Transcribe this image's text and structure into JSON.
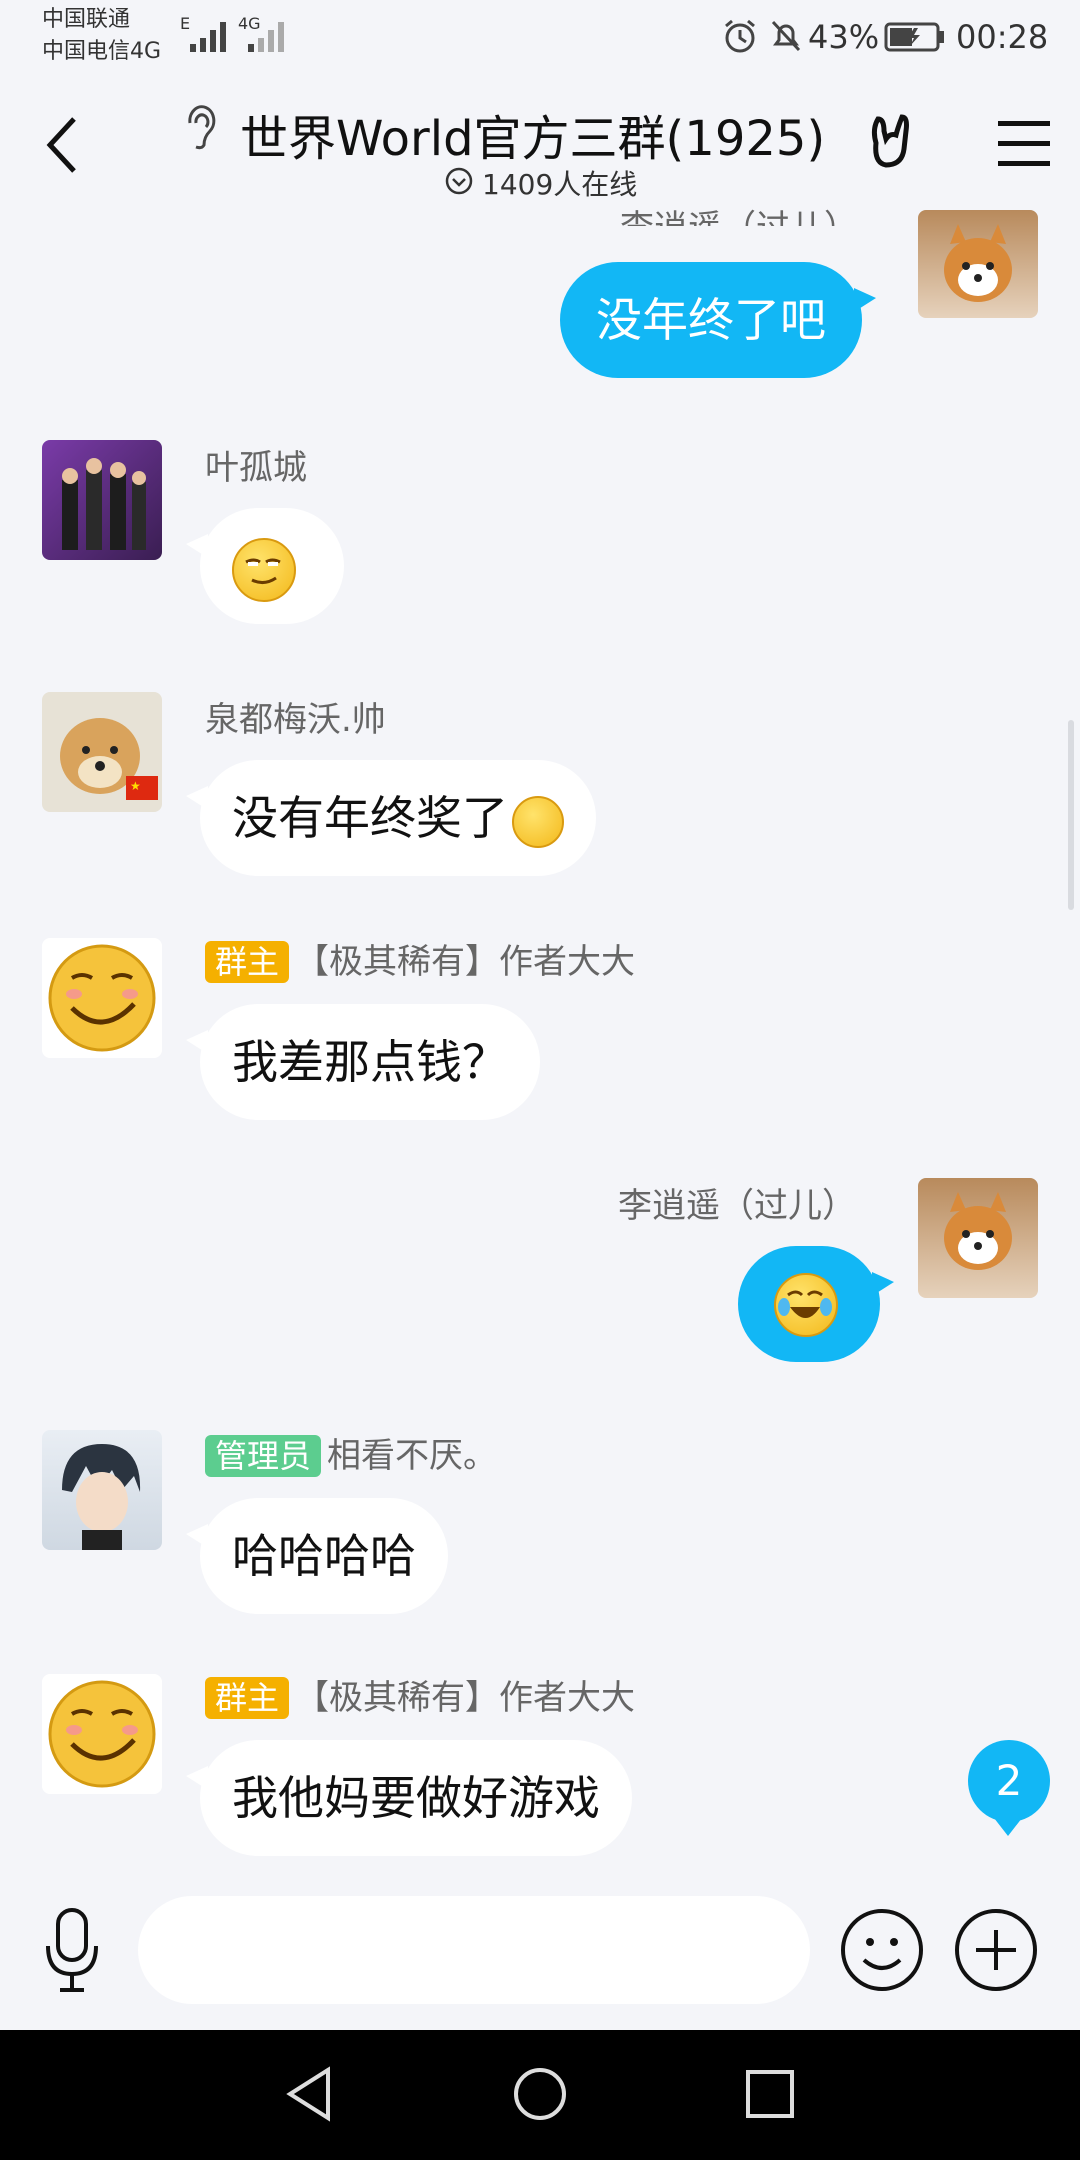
{
  "status_bar": {
    "carrier1": "中国联通",
    "carrier2": "中国电信4G",
    "net1": "E",
    "net2": "4G",
    "battery": "43%",
    "time": "00:28"
  },
  "header": {
    "title": "世界World官方三群(1925)",
    "online": "1409人在线"
  },
  "messages": [
    {
      "side": "right",
      "name": "李逍遥（过儿）",
      "text": "没年终了吧"
    },
    {
      "side": "left",
      "name": "叶孤城",
      "emoji": "smirk-face"
    },
    {
      "side": "left",
      "name": "泉都梅沃.帅",
      "text": "没有年终奖了"
    },
    {
      "side": "left",
      "tag": "群主",
      "name": "【极其稀有】作者大大",
      "text": "我差那点钱？"
    },
    {
      "side": "right",
      "name": "李逍遥（过儿）",
      "emoji": "tears-of-joy-face"
    },
    {
      "side": "left",
      "tag": "管理员",
      "name": "相看不厌。",
      "text": "哈哈哈哈"
    },
    {
      "side": "left",
      "tag": "群主",
      "name": "【极其稀有】作者大大",
      "text": "我他妈要做好游戏"
    }
  ],
  "unread_count": "2",
  "colors": {
    "accent": "#12b7f5",
    "owner_tag": "#f5b000",
    "admin_tag": "#5ccd8f"
  }
}
